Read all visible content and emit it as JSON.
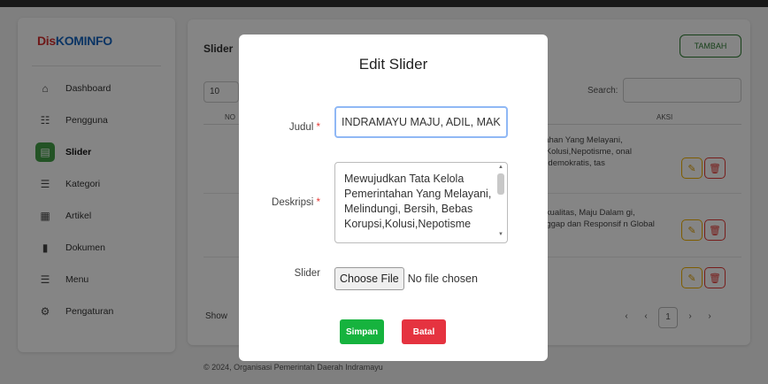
{
  "brand": {
    "part1": "Dis",
    "part2": "KOMINFO"
  },
  "sidebar": {
    "items": [
      {
        "icon": "home-icon",
        "glyph": "⌂",
        "label": "Dashboard",
        "active": false
      },
      {
        "icon": "users-icon",
        "glyph": "☷",
        "label": "Pengguna",
        "active": false
      },
      {
        "icon": "slider-icon",
        "glyph": "▤",
        "label": "Slider",
        "active": true
      },
      {
        "icon": "list-icon",
        "glyph": "☰",
        "label": "Kategori",
        "active": false
      },
      {
        "icon": "article-icon",
        "glyph": "▦",
        "label": "Artikel",
        "active": false
      },
      {
        "icon": "document-icon",
        "glyph": "▮",
        "label": "Dokumen",
        "active": false
      },
      {
        "icon": "menu-icon",
        "glyph": "☰",
        "label": "Menu",
        "active": false
      },
      {
        "icon": "settings-icon",
        "glyph": "⚙",
        "label": "Pengaturan",
        "active": false
      }
    ]
  },
  "main": {
    "title": "Slider",
    "tambah_label": "TAMBAH",
    "entries_value": "10",
    "search_label": "Search:",
    "col_no": "NO",
    "col_aksi": "AKSI",
    "rows": [
      {
        "text": "rintahan Yang Melayani, psi,Kolusi,Nepotisme, onal Dandemokratis, tas"
      },
      {
        "text": "Berkualitas, Maju Dalam gi, Tanggap dan Responsif n Global"
      },
      {
        "text": ""
      }
    ],
    "show_label": "Show",
    "pagination": {
      "prev": "‹",
      "prev2": "‹",
      "current": "1",
      "next": "›",
      "next2": "›"
    }
  },
  "footer": "© 2024, Organisasi Pemerintah Daerah Indramayu",
  "modal": {
    "title": "Edit Slider",
    "judul_label": "Judul",
    "judul_value": "INDRAMAYU MAJU, ADIL, MAKMUR",
    "deskripsi_label": "Deskripsi",
    "deskripsi_value": "Mewujudkan Tata Kelola Pemerintahan Yang Melayani, Melindungi, Bersih, Bebas Korupsi,Kolusi,Nepotisme",
    "slider_label": "Slider",
    "file_button": "Choose File",
    "file_status": "No file chosen",
    "required_mark": "*",
    "save_label": "Simpan",
    "cancel_label": "Batal"
  },
  "colors": {
    "active": "#43a047",
    "save": "#16b33e",
    "cancel": "#e53340",
    "edit": "#f2b100",
    "delete": "#e53935"
  }
}
